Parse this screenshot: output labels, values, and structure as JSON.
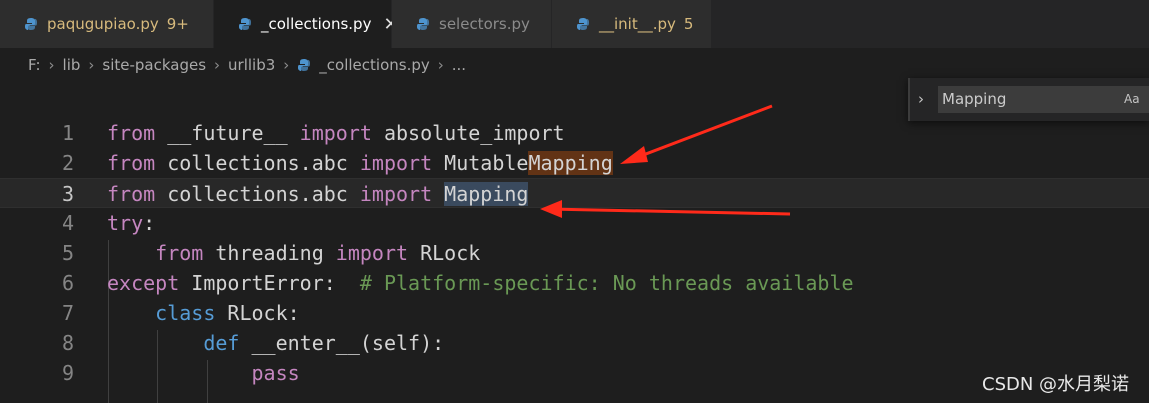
{
  "tabs": [
    {
      "label": "paqugupiao.py",
      "badge": "9+",
      "state": "warn"
    },
    {
      "label": "_collections.py",
      "badge": "",
      "state": "active",
      "close": "✕"
    },
    {
      "label": "selectors.py",
      "badge": "",
      "state": "normal"
    },
    {
      "label": "__init__.py",
      "badge": "5",
      "state": "warn2"
    }
  ],
  "breadcrumb": {
    "items": [
      "F:",
      "lib",
      "site-packages",
      "urllib3",
      "_collections.py",
      "..."
    ]
  },
  "find": {
    "value": "Mapping",
    "match_case_label": "Aa",
    "toggle_icon": "chevron-right-icon"
  },
  "editor": {
    "lines": [
      {
        "n": "1",
        "parts": [
          {
            "t": "from",
            "c": "kw2"
          },
          {
            "t": " __future__ ",
            "c": "tx"
          },
          {
            "t": "import",
            "c": "kw2"
          },
          {
            "t": " absolute_import",
            "c": "tx"
          }
        ]
      },
      {
        "n": "2",
        "parts": [
          {
            "t": "from",
            "c": "kw2"
          },
          {
            "t": " collections.abc ",
            "c": "tx"
          },
          {
            "t": "import",
            "c": "kw2"
          },
          {
            "t": " Mutable",
            "c": "tx"
          },
          {
            "t": "Mapping",
            "c": "tx hl1"
          }
        ]
      },
      {
        "n": "3",
        "current": true,
        "parts": [
          {
            "t": "from",
            "c": "kw2"
          },
          {
            "t": " collections.abc ",
            "c": "tx"
          },
          {
            "t": "import",
            "c": "kw2"
          },
          {
            "t": " ",
            "c": "tx"
          },
          {
            "t": "Mapping",
            "c": "tx hl2"
          }
        ]
      },
      {
        "n": "4",
        "parts": [
          {
            "t": "try",
            "c": "kw2"
          },
          {
            "t": ":",
            "c": "tx"
          }
        ]
      },
      {
        "n": "5",
        "parts": [
          {
            "t": "    ",
            "c": "tx"
          },
          {
            "t": "from",
            "c": "kw2"
          },
          {
            "t": " threading ",
            "c": "tx"
          },
          {
            "t": "import",
            "c": "kw2"
          },
          {
            "t": " RLock",
            "c": "tx"
          }
        ]
      },
      {
        "n": "6",
        "parts": [
          {
            "t": "except",
            "c": "kw2"
          },
          {
            "t": " ImportError:  ",
            "c": "tx"
          },
          {
            "t": "# Platform-specific: No threads available",
            "c": "cm"
          }
        ]
      },
      {
        "n": "7",
        "parts": [
          {
            "t": "    ",
            "c": "tx"
          },
          {
            "t": "class",
            "c": "kw"
          },
          {
            "t": " RLock:",
            "c": "tx"
          }
        ]
      },
      {
        "n": "8",
        "parts": [
          {
            "t": "        ",
            "c": "tx"
          },
          {
            "t": "def",
            "c": "kw"
          },
          {
            "t": " __enter__(self):",
            "c": "tx"
          }
        ]
      },
      {
        "n": "9",
        "parts": [
          {
            "t": "            ",
            "c": "tx"
          },
          {
            "t": "pass",
            "c": "kw2"
          }
        ]
      }
    ]
  },
  "watermark": "CSDN @水月梨诺",
  "colors": {
    "keyword_control": "#c586c0",
    "keyword": "#569cd6",
    "comment": "#6a9955",
    "match_highlight": "#623315",
    "selection_highlight": "#3a4a5e",
    "annotation_arrow": "#ff2a1a"
  }
}
